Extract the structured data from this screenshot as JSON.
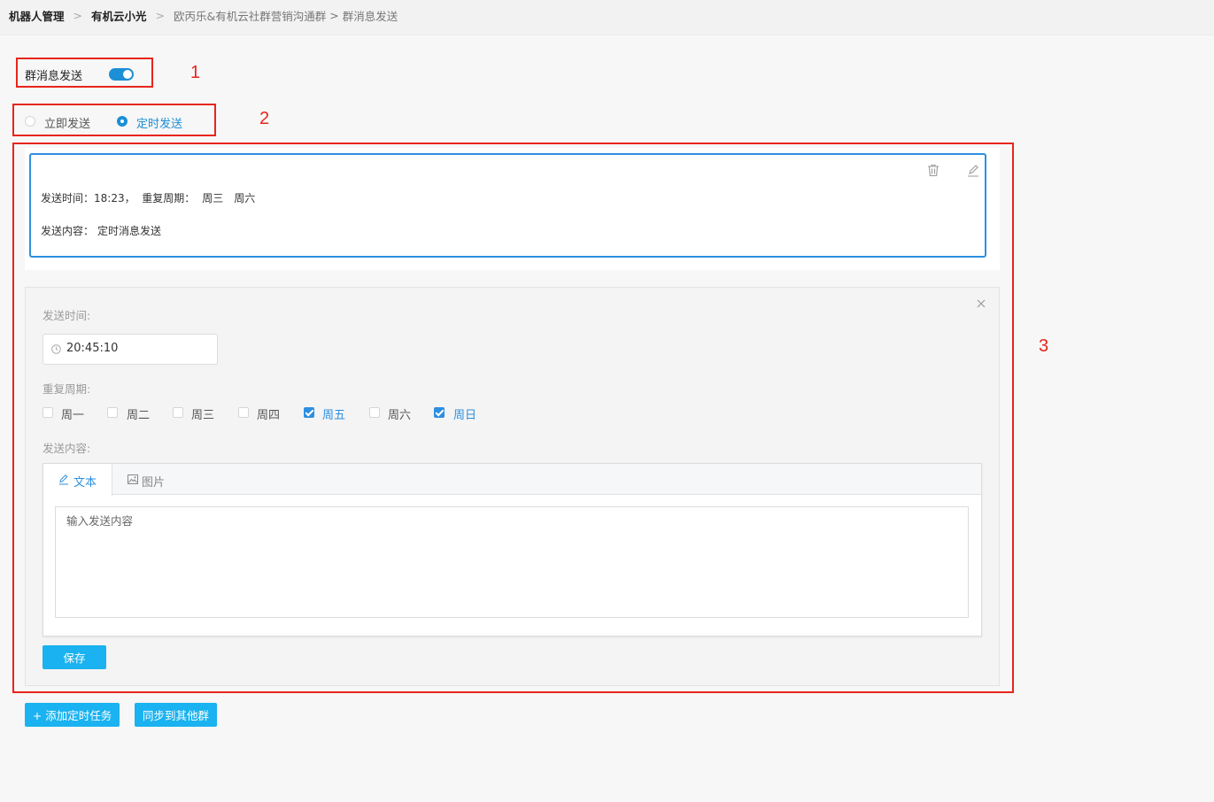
{
  "breadcrumb": {
    "items": [
      "机器人管理",
      "有机云小光",
      "欧丙乐&有机云社群营销沟通群",
      "群消息发送"
    ],
    "sep": ">"
  },
  "annotations": [
    "1",
    "2",
    "3"
  ],
  "toggle": {
    "label": "群消息发送",
    "on": true
  },
  "send_mode": {
    "options": [
      "立即发送",
      "定时发送"
    ],
    "selected": "定时发送"
  },
  "task": {
    "time_label": "发送时间：",
    "time_value": "18:23",
    "repeat_label": "，  重复周期：",
    "repeat_days": [
      "周三",
      "周六"
    ],
    "content_label": "发送内容：",
    "content_value": "定时消息发送"
  },
  "editor": {
    "time_label": "发送时间:",
    "time_value": "20:45:10",
    "repeat_label": "重复周期:",
    "weekdays": [
      {
        "label": "周一",
        "checked": false
      },
      {
        "label": "周二",
        "checked": false
      },
      {
        "label": "周三",
        "checked": false
      },
      {
        "label": "周四",
        "checked": false
      },
      {
        "label": "周五",
        "checked": true
      },
      {
        "label": "周六",
        "checked": false
      },
      {
        "label": "周日",
        "checked": true
      }
    ],
    "content_label": "发送内容:",
    "tabs": [
      "文本",
      "图片"
    ],
    "active_tab": "文本",
    "placeholder": "输入发送内容",
    "save": "保存"
  },
  "actions": {
    "add_task": "+ 添加定时任务",
    "sync": "同步到其他群"
  },
  "colors": {
    "accent": "#1c8fd6",
    "button": "#1ab2f0",
    "annotation": "#e8251c"
  }
}
